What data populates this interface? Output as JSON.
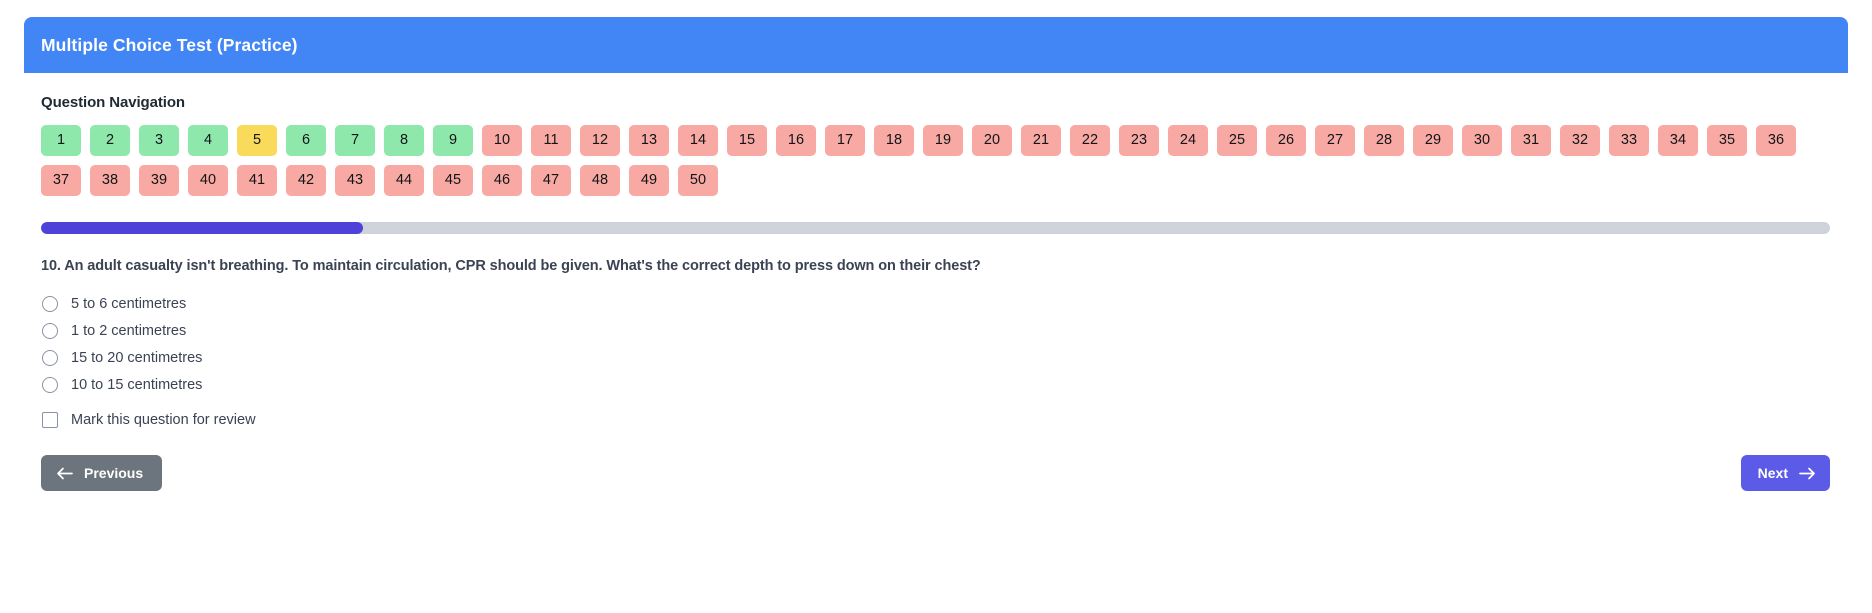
{
  "header": {
    "title": "Multiple Choice Test (Practice)",
    "background_color": "#4285f4"
  },
  "navigation": {
    "section_title": "Question Navigation",
    "legend_colors": {
      "answered": "#8ee8ac",
      "current": "#f9da5a",
      "unanswered": "#f8a9a3"
    },
    "buttons": [
      {
        "label": "1",
        "state": "answered"
      },
      {
        "label": "2",
        "state": "answered"
      },
      {
        "label": "3",
        "state": "answered"
      },
      {
        "label": "4",
        "state": "answered"
      },
      {
        "label": "5",
        "state": "current"
      },
      {
        "label": "6",
        "state": "answered"
      },
      {
        "label": "7",
        "state": "answered"
      },
      {
        "label": "8",
        "state": "answered"
      },
      {
        "label": "9",
        "state": "answered"
      },
      {
        "label": "10",
        "state": "unanswered"
      },
      {
        "label": "11",
        "state": "unanswered"
      },
      {
        "label": "12",
        "state": "unanswered"
      },
      {
        "label": "13",
        "state": "unanswered"
      },
      {
        "label": "14",
        "state": "unanswered"
      },
      {
        "label": "15",
        "state": "unanswered"
      },
      {
        "label": "16",
        "state": "unanswered"
      },
      {
        "label": "17",
        "state": "unanswered"
      },
      {
        "label": "18",
        "state": "unanswered"
      },
      {
        "label": "19",
        "state": "unanswered"
      },
      {
        "label": "20",
        "state": "unanswered"
      },
      {
        "label": "21",
        "state": "unanswered"
      },
      {
        "label": "22",
        "state": "unanswered"
      },
      {
        "label": "23",
        "state": "unanswered"
      },
      {
        "label": "24",
        "state": "unanswered"
      },
      {
        "label": "25",
        "state": "unanswered"
      },
      {
        "label": "26",
        "state": "unanswered"
      },
      {
        "label": "27",
        "state": "unanswered"
      },
      {
        "label": "28",
        "state": "unanswered"
      },
      {
        "label": "29",
        "state": "unanswered"
      },
      {
        "label": "30",
        "state": "unanswered"
      },
      {
        "label": "31",
        "state": "unanswered"
      },
      {
        "label": "32",
        "state": "unanswered"
      },
      {
        "label": "33",
        "state": "unanswered"
      },
      {
        "label": "34",
        "state": "unanswered"
      },
      {
        "label": "35",
        "state": "unanswered"
      },
      {
        "label": "36",
        "state": "unanswered"
      },
      {
        "label": "37",
        "state": "unanswered"
      },
      {
        "label": "38",
        "state": "unanswered"
      },
      {
        "label": "39",
        "state": "unanswered"
      },
      {
        "label": "40",
        "state": "unanswered"
      },
      {
        "label": "41",
        "state": "unanswered"
      },
      {
        "label": "42",
        "state": "unanswered"
      },
      {
        "label": "43",
        "state": "unanswered"
      },
      {
        "label": "44",
        "state": "unanswered"
      },
      {
        "label": "45",
        "state": "unanswered"
      },
      {
        "label": "46",
        "state": "unanswered"
      },
      {
        "label": "47",
        "state": "unanswered"
      },
      {
        "label": "48",
        "state": "unanswered"
      },
      {
        "label": "49",
        "state": "unanswered"
      },
      {
        "label": "50",
        "state": "unanswered"
      }
    ]
  },
  "progress": {
    "percent": 18,
    "fill_color": "#4f42d8",
    "track_color": "#ced4da"
  },
  "question": {
    "number": "10",
    "text": "10. An adult casualty isn't breathing. To maintain circulation, CPR should be given. What's the correct depth to press down on their chest?",
    "options": [
      {
        "label": "5 to 6 centimetres",
        "selected": false
      },
      {
        "label": "1 to 2 centimetres",
        "selected": false
      },
      {
        "label": "15 to 20 centimetres",
        "selected": false
      },
      {
        "label": "10 to 15 centimetres",
        "selected": false
      }
    ],
    "review": {
      "label": "Mark this question for review",
      "checked": false
    }
  },
  "footer": {
    "previous_label": "Previous",
    "next_label": "Next",
    "previous_color": "#6c757d",
    "next_color": "#5b5be8"
  }
}
